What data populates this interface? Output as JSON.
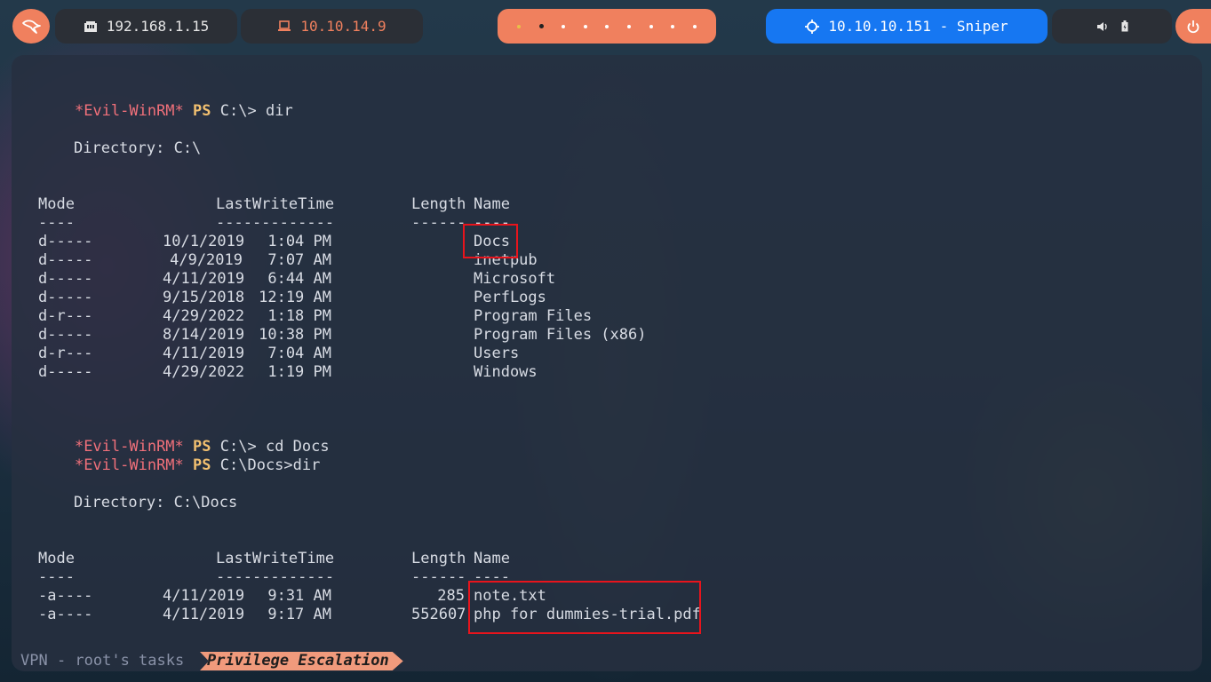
{
  "topbar": {
    "local_ip": "192.168.1.15",
    "vpn_ip": "10.10.14.9",
    "target": "10.10.10.151 - Sniper",
    "workspaces": 9,
    "active_workspace": 2
  },
  "terminal": {
    "prompt": {
      "star": "*Evil-WinRM*",
      "ps": "PS"
    },
    "block1": {
      "cwd": "C:\\>",
      "command": "dir",
      "directory_label": "Directory: C:\\",
      "headers": {
        "mode": "Mode",
        "lwt": "LastWriteTime",
        "length": "Length",
        "name": "Name"
      },
      "underlines": {
        "mode": "----",
        "lwt": "-------------",
        "length": "------",
        "name": "----"
      },
      "rows": [
        {
          "mode": "d-----",
          "date": "10/1/2019",
          "time": "1:04 PM",
          "length": "",
          "name": "Docs"
        },
        {
          "mode": "d-----",
          "date": "4/9/2019",
          "time": "7:07 AM",
          "length": "",
          "name": "inetpub"
        },
        {
          "mode": "d-----",
          "date": "4/11/2019",
          "time": "6:44 AM",
          "length": "",
          "name": "Microsoft"
        },
        {
          "mode": "d-----",
          "date": "9/15/2018",
          "time": "12:19 AM",
          "length": "",
          "name": "PerfLogs"
        },
        {
          "mode": "d-r---",
          "date": "4/29/2022",
          "time": "1:18 PM",
          "length": "",
          "name": "Program Files"
        },
        {
          "mode": "d-----",
          "date": "8/14/2019",
          "time": "10:38 PM",
          "length": "",
          "name": "Program Files (x86)"
        },
        {
          "mode": "d-r---",
          "date": "4/11/2019",
          "time": "7:04 AM",
          "length": "",
          "name": "Users"
        },
        {
          "mode": "d-----",
          "date": "4/29/2022",
          "time": "1:19 PM",
          "length": "",
          "name": "Windows"
        }
      ]
    },
    "cmd2": {
      "cwd": "C:\\>",
      "command": "cd Docs"
    },
    "block2": {
      "cwd": "C:\\Docs>",
      "command": "dir",
      "directory_label": "Directory: C:\\Docs",
      "headers": {
        "mode": "Mode",
        "lwt": "LastWriteTime",
        "length": "Length",
        "name": "Name"
      },
      "underlines": {
        "mode": "----",
        "lwt": "-------------",
        "length": "------",
        "name": "----"
      },
      "rows": [
        {
          "mode": "-a----",
          "date": "4/11/2019",
          "time": "9:31 AM",
          "length": "285",
          "name": "note.txt"
        },
        {
          "mode": "-a----",
          "date": "4/11/2019",
          "time": "9:17 AM",
          "length": "552607",
          "name": "php for dummies-trial.pdf"
        }
      ]
    }
  },
  "statusbar": {
    "session": "VPN - root's tasks",
    "tab": "Privilege Escalation"
  },
  "colors": {
    "accent": "#f0805e",
    "target_pill": "#1677f2",
    "highlight_box": "#e8141c",
    "prompt_star": "#f0707a",
    "prompt_ps": "#f2c070"
  }
}
